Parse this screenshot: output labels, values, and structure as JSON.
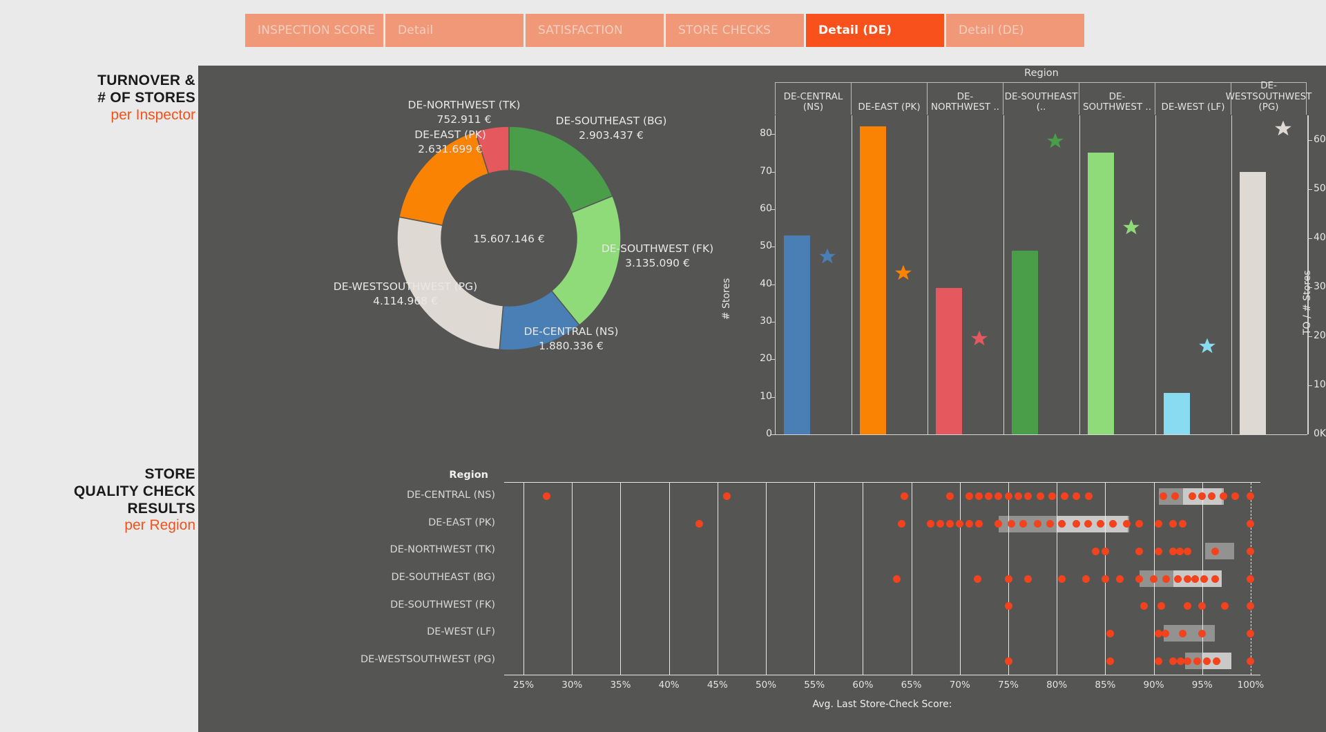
{
  "tabs": [
    {
      "label": "INSPECTION SCORE",
      "active": false
    },
    {
      "label": "Detail",
      "active": false
    },
    {
      "label": "SATISFACTION",
      "active": false
    },
    {
      "label": "STORE CHECKS",
      "active": false
    },
    {
      "label": "Detail (DE)",
      "active": true
    },
    {
      "label": "Detail (DE)",
      "active": false
    }
  ],
  "sidebar": {
    "top": {
      "line1": "TURNOVER &",
      "line2": "# OF STORES",
      "sub": "per Inspector"
    },
    "bottom": {
      "line1": "STORE",
      "line2": "QUALITY CHECK",
      "line3": "RESULTS",
      "sub": "per Region"
    }
  },
  "colors": {
    "accent": "#f8511b",
    "tab_inactive": "#f09878",
    "canvas": "#555554",
    "blue": "#4a7fb5",
    "orange": "#fb8303",
    "red": "#e4585e",
    "green": "#4a9e4a",
    "lightgreen": "#8fdb79",
    "cyan": "#89dcf0",
    "beige": "#dfd9d3",
    "dot": "#f4421d"
  },
  "chart_data": [
    {
      "type": "pie",
      "title": "Turnover per Inspector",
      "center_label": "15.607.146 €",
      "total": 15607146,
      "labels": [
        "DE-SOUTHEAST (BG)",
        "DE-SOUTHWEST (FK)",
        "DE-CENTRAL (NS)",
        "DE-WESTSOUTHWEST (PG)",
        "DE-EAST (PK)",
        "DE-NORTHWEST (TK)"
      ],
      "value_labels": [
        "2.903.437 €",
        "3.135.090 €",
        "1.880.336 €",
        "4.114.968 €",
        "2.631.699 €",
        "752.911 €"
      ],
      "values": [
        2903437,
        3135090,
        1880336,
        4114968,
        2631699,
        752911
      ],
      "colors": [
        "#4a9e4a",
        "#8fdb79",
        "#4a7fb5",
        "#dfd9d3",
        "#fb8303",
        "#e4585e"
      ],
      "legend": "labels-outside"
    },
    {
      "type": "bar",
      "title": "Region",
      "ylabel": "# Stores",
      "y2label": "TO / # Stores",
      "xlabel": "Region",
      "categories": [
        "DE-CENTRAL (NS)",
        "DE-EAST (PK)",
        "DE-NORTHWEST ..",
        "DE-SOUTHEAST (..",
        "DE-SOUTHWEST ..",
        "DE-WEST (LF)",
        "DE-WESTSOUTHWEST (PG)"
      ],
      "series": [
        {
          "name": "# Stores",
          "type": "bar",
          "values": [
            53,
            82,
            39,
            49,
            75,
            11,
            70
          ],
          "colors": [
            "#4a7fb5",
            "#fb8303",
            "#e4585e",
            "#4a9e4a",
            "#8fdb79",
            "#89dcf0",
            "#dfd9d3"
          ]
        },
        {
          "name": "TO / # Stores",
          "type": "star",
          "values": [
            35500,
            32100,
            18700,
            59000,
            41300,
            17200,
            61500
          ],
          "colors": [
            "#4a7fb5",
            "#fb8303",
            "#e4585e",
            "#4a9e4a",
            "#8fdb79",
            "#89dcf0",
            "#dfd9d3"
          ]
        }
      ],
      "yticks": [
        "0",
        "10",
        "20",
        "30",
        "40",
        "50",
        "60",
        "70",
        "80"
      ],
      "ylim": [
        0,
        85
      ],
      "y2ticks": [
        "0K",
        "10K",
        "20K",
        "30K",
        "40K",
        "50K",
        "60K"
      ],
      "y2lim": [
        0,
        65000
      ],
      "grid": true
    },
    {
      "type": "scatter",
      "title": "Store Quality Check Results per Region",
      "xlabel": "Avg. Last Store-Check Score:",
      "ylabel": "Region",
      "yheader": "Region",
      "categories": [
        "DE-CENTRAL (NS)",
        "DE-EAST (PK)",
        "DE-NORTHWEST (TK)",
        "DE-SOUTHEAST (BG)",
        "DE-SOUTHWEST (FK)",
        "DE-WEST (LF)",
        "DE-WESTSOUTHWEST (PG)"
      ],
      "xticks": [
        "25%",
        "30%",
        "35%",
        "40%",
        "45%",
        "50%",
        "55%",
        "60%",
        "65%",
        "70%",
        "75%",
        "80%",
        "85%",
        "90%",
        "95%",
        "100%"
      ],
      "xlim": [
        23,
        101
      ],
      "rows": [
        {
          "category": "DE-CENTRAL (NS)",
          "reference_bands": [
            {
              "from": 90.5,
              "to": 97.0,
              "shade": "dark"
            },
            {
              "from": 93.0,
              "to": 97.2,
              "shade": "light"
            }
          ],
          "points": [
            27.4,
            46.0,
            64.3,
            69.0,
            71.0,
            72.0,
            73.0,
            74.0,
            75.0,
            76.0,
            77.0,
            78.3,
            79.5,
            80.8,
            82.0,
            83.3,
            91.0,
            92.2,
            94.0,
            95.0,
            96.0,
            97.2,
            98.4,
            100.0
          ]
        },
        {
          "category": "DE-EAST (PK)",
          "reference_bands": [
            {
              "from": 74.0,
              "to": 87.5,
              "shade": "dark"
            },
            {
              "from": 80.0,
              "to": 87.3,
              "shade": "light"
            }
          ],
          "points": [
            43.1,
            64.0,
            67.0,
            68.0,
            69.0,
            70.0,
            71.0,
            72.0,
            74.0,
            75.3,
            76.5,
            78.0,
            79.3,
            80.5,
            82.0,
            83.2,
            84.5,
            85.8,
            87.2,
            88.5,
            90.5,
            92.0,
            93.0,
            100.0
          ]
        },
        {
          "category": "DE-NORTHWEST (TK)",
          "reference_bands": [
            {
              "from": 95.3,
              "to": 98.3,
              "shade": "dark"
            }
          ],
          "points": [
            84.0,
            85.0,
            88.5,
            90.5,
            92.0,
            92.7,
            93.5,
            96.3,
            100.0
          ]
        },
        {
          "category": "DE-SOUTHEAST (BG)",
          "reference_bands": [
            {
              "from": 88.5,
              "to": 97.0,
              "shade": "dark"
            },
            {
              "from": 92.0,
              "to": 97.0,
              "shade": "light"
            }
          ],
          "points": [
            63.5,
            71.8,
            75.0,
            77.0,
            80.5,
            83.0,
            85.0,
            86.5,
            88.5,
            90.0,
            91.3,
            92.5,
            93.5,
            94.3,
            95.2,
            96.3,
            100.0
          ]
        },
        {
          "category": "DE-SOUTHWEST (FK)",
          "reference_bands": [],
          "points": [
            75.0,
            89.0,
            90.8,
            93.5,
            95.0,
            97.3,
            100.0
          ]
        },
        {
          "category": "DE-WEST (LF)",
          "reference_bands": [
            {
              "from": 91.0,
              "to": 96.3,
              "shade": "dark"
            }
          ],
          "points": [
            85.5,
            90.5,
            91.2,
            93.0,
            95.0,
            100.0
          ]
        },
        {
          "category": "DE-WESTSOUTHWEST (PG)",
          "reference_bands": [
            {
              "from": 93.2,
              "to": 98.0,
              "shade": "dark"
            },
            {
              "from": 95.0,
              "to": 98.0,
              "shade": "light"
            }
          ],
          "points": [
            75.0,
            85.5,
            90.5,
            92.0,
            92.8,
            93.5,
            94.5,
            95.5,
            96.5,
            100.0
          ]
        }
      ]
    }
  ]
}
